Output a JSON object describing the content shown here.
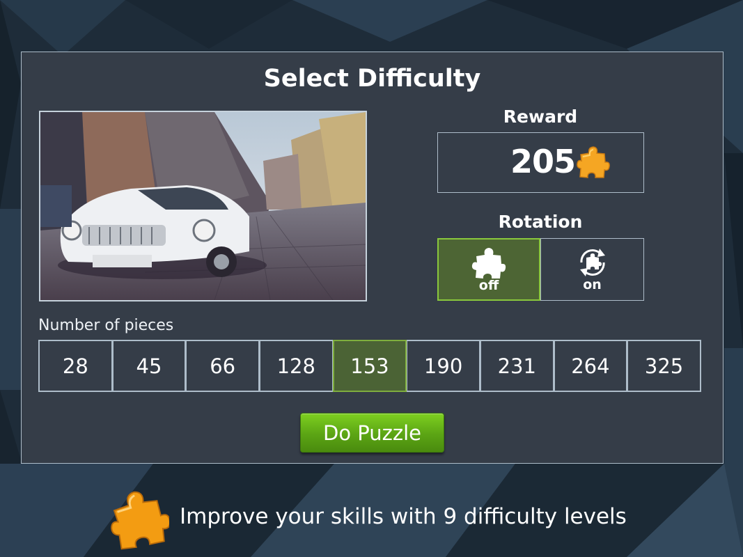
{
  "dialog": {
    "title": "Select Difficulty",
    "preview_image": "vintage white car on cobblestone street"
  },
  "reward": {
    "label": "Reward",
    "value": "205",
    "icon": "puzzle-piece-icon"
  },
  "rotation": {
    "label": "Rotation",
    "options": [
      {
        "label": "off",
        "icon": "puzzle-piece-icon",
        "selected": true
      },
      {
        "label": "on",
        "icon": "rotate-puzzle-icon",
        "selected": false
      }
    ]
  },
  "pieces": {
    "label": "Number of pieces",
    "options": [
      "28",
      "45",
      "66",
      "128",
      "153",
      "190",
      "231",
      "264",
      "325"
    ],
    "selected": "153"
  },
  "actions": {
    "do_puzzle_label": "Do Puzzle"
  },
  "footer": {
    "text": "Improve your skills with 9 difficulty levels"
  },
  "colors": {
    "panel": "#353d48",
    "selected_green": "#4b6335",
    "button_green": "#5ba414",
    "puzzle_orange": "#f5a623"
  }
}
